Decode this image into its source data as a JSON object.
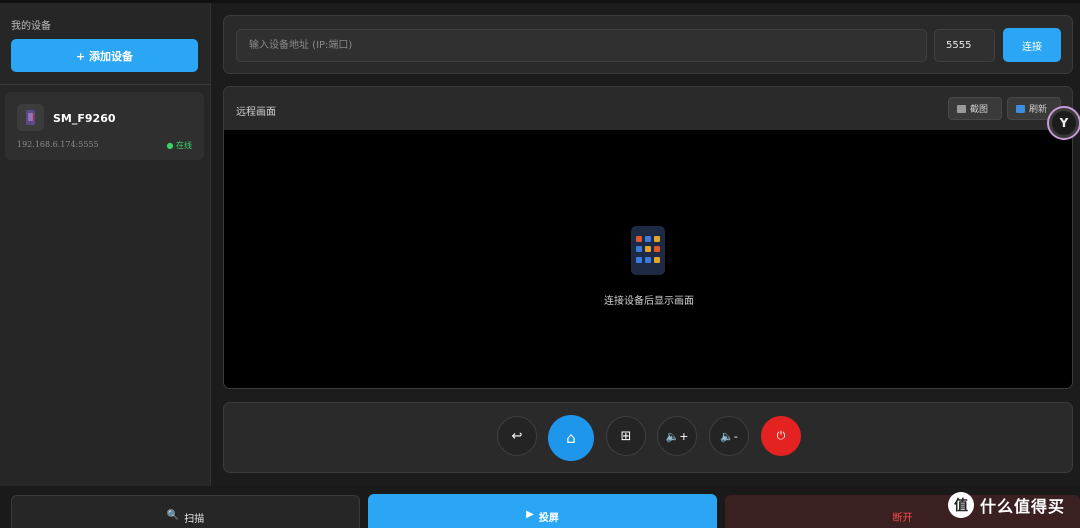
{
  "sidebar": {
    "title": "我的设备",
    "add_device_label": "+ 添加设备",
    "devices": [
      {
        "name": "SM_F9260",
        "address": "192.168.6.174:5555",
        "status": "● 在线"
      }
    ]
  },
  "connection": {
    "ip_placeholder": "输入设备地址 (IP:端口)",
    "port_value": "5555",
    "connect_label": "连接"
  },
  "screen": {
    "title": "远程画面",
    "screenshot_label": "截图",
    "refresh_label": "刷新",
    "empty_message": "连接设备后显示画面"
  },
  "controls": {
    "back_icon": "↩",
    "home_icon": "⌂",
    "apps_icon": "⊞",
    "vol_up_label": "🔈+",
    "vol_down_label": "🔈-",
    "power_icon": "⏻"
  },
  "bottom": {
    "scan_label": "扫描",
    "cast_label": "投屏",
    "disconnect_label": "断开"
  },
  "watermark": {
    "logo": "值",
    "text": "什么值得买"
  },
  "colors": {
    "accent": "#2aa6f5",
    "online": "#39d36b",
    "danger": "#e52222"
  }
}
